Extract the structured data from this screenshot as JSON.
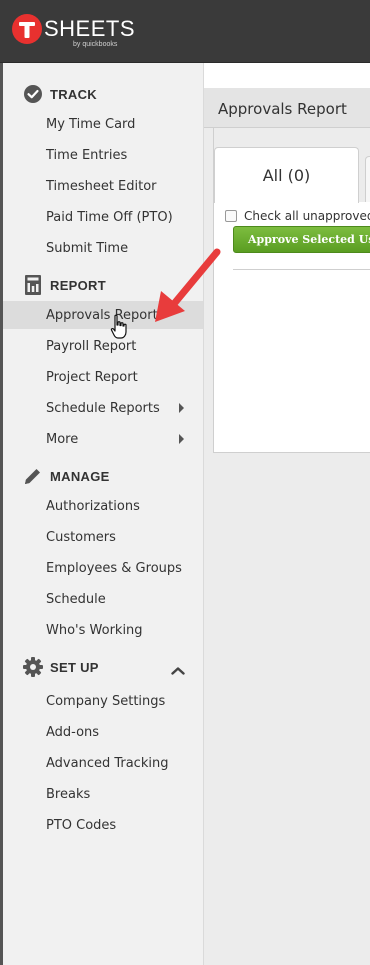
{
  "header": {
    "logo_word": "SHEETS",
    "logo_sub": "by quickbooks",
    "logo_letter": "T"
  },
  "sidebar": {
    "sections": [
      {
        "title": "TRACK",
        "icon": "checkmark-circle-icon",
        "items": [
          {
            "label": "My Time Card"
          },
          {
            "label": "Time Entries"
          },
          {
            "label": "Timesheet Editor"
          },
          {
            "label": "Paid Time Off (PTO)"
          },
          {
            "label": "Submit Time"
          }
        ]
      },
      {
        "title": "REPORT",
        "icon": "report-calculator-icon",
        "items": [
          {
            "label": "Approvals Report",
            "active": true
          },
          {
            "label": "Payroll Report"
          },
          {
            "label": "Project Report"
          },
          {
            "label": "Schedule Reports",
            "has_submenu": true
          },
          {
            "label": "More",
            "has_submenu": true
          }
        ]
      },
      {
        "title": "MANAGE",
        "icon": "pencil-icon",
        "items": [
          {
            "label": "Authorizations"
          },
          {
            "label": "Customers"
          },
          {
            "label": "Employees & Groups"
          },
          {
            "label": "Schedule"
          },
          {
            "label": "Who's Working"
          }
        ]
      },
      {
        "title": "SET UP",
        "icon": "gear-icon",
        "collapsible": true,
        "items": [
          {
            "label": "Company Settings"
          },
          {
            "label": "Add-ons"
          },
          {
            "label": "Advanced Tracking"
          },
          {
            "label": "Breaks"
          },
          {
            "label": "PTO Codes"
          }
        ]
      }
    ]
  },
  "main": {
    "panel_title": "Approvals Report",
    "tabs": [
      {
        "label": "All (0)",
        "active": true
      }
    ],
    "check_all_label": "Check all unapproved",
    "approve_button": "Approve Selected Users"
  },
  "colors": {
    "header_bg": "#3a3a3a",
    "logo_red": "#e8312f",
    "sidebar_bg": "#f1f1f1",
    "active_item_bg": "#dcdcdc",
    "approve_green": "#6aad2e",
    "annotation_arrow": "#e83c3c"
  }
}
